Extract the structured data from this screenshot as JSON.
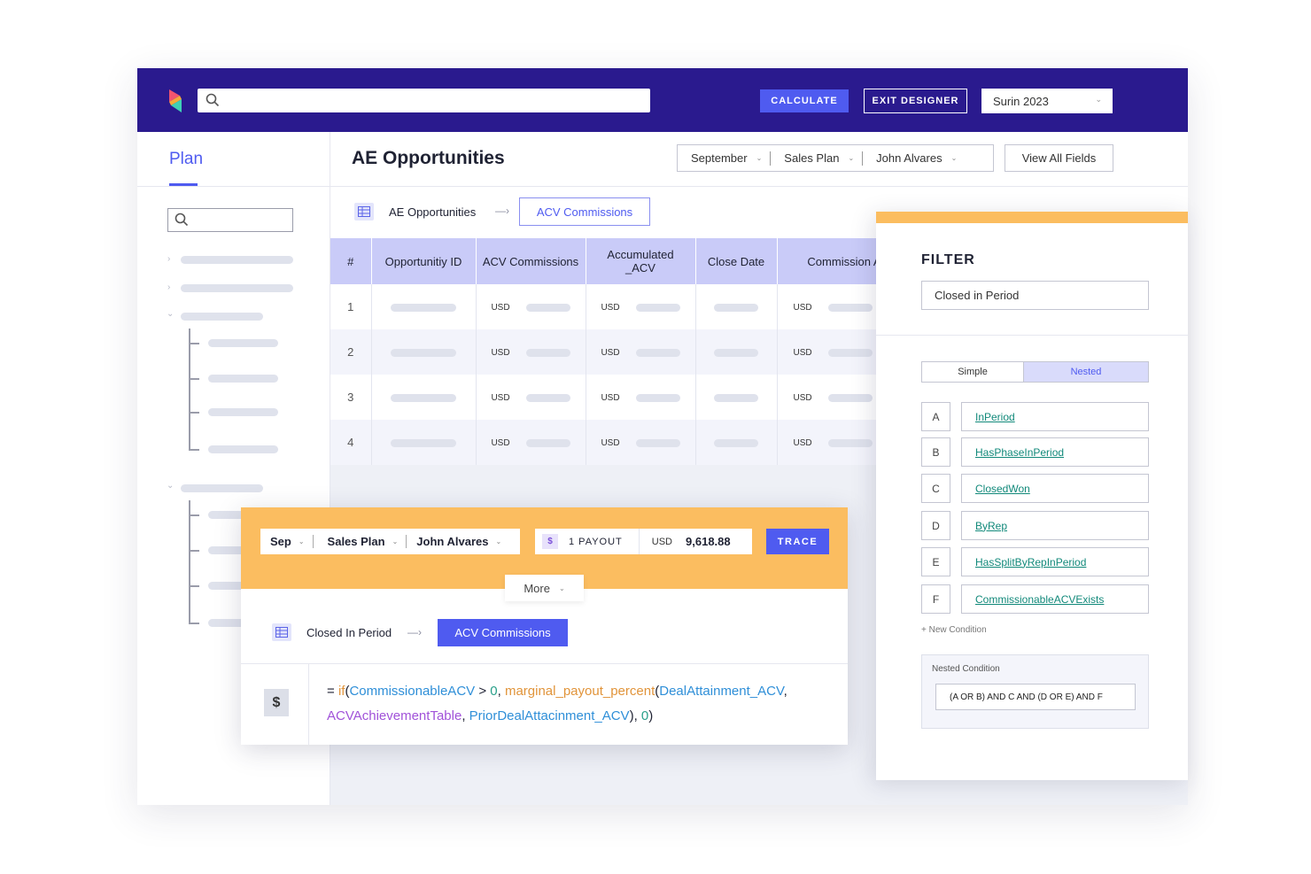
{
  "topbar": {
    "calculate_label": "CALCULATE",
    "exit_label": "EXIT DESIGNER",
    "plan_year": "Surin 2023"
  },
  "sidebar": {
    "tab_label": "Plan"
  },
  "main": {
    "title": "AE Opportunities",
    "filters": [
      "September",
      "Sales Plan",
      "John Alvares"
    ],
    "view_all_label": "View All Fields",
    "breadcrumb_source": "AE Opportunities",
    "breadcrumb_target": "ACV Commissions"
  },
  "table": {
    "headers": [
      "#",
      "Opportunitiy ID",
      "ACV Commissions",
      "Accumulated _ACV",
      "Close Date",
      "Commission ACV"
    ],
    "currency": "USD",
    "rows": [
      "1",
      "2",
      "3",
      "4"
    ]
  },
  "filter_panel": {
    "title": "FILTER",
    "filter_value": "Closed in Period",
    "mode_simple": "Simple",
    "mode_nested": "Nested",
    "conditions": [
      {
        "letter": "A",
        "field": "InPeriod"
      },
      {
        "letter": "B",
        "field": "HasPhaseInPeriod"
      },
      {
        "letter": "C",
        "field": "ClosedWon"
      },
      {
        "letter": "D",
        "field": "ByRep"
      },
      {
        "letter": "E",
        "field": "HasSplitByRepInPeriod"
      },
      {
        "letter": "F",
        "field": "CommissionableACVExists"
      }
    ],
    "new_condition_label": "+ New Condition",
    "nested_label": "Nested Condition",
    "nested_value": "(A OR B) AND C AND (D OR E) AND F"
  },
  "trace_card": {
    "period": "Sep",
    "plan": "Sales Plan",
    "rep": "John Alvares",
    "payout_icon": "$",
    "payout_label": "1 PAYOUT",
    "currency": "USD",
    "payout_value": "9,618.88",
    "trace_label": "TRACE",
    "more_label": "More",
    "breadcrumb_source": "Closed In Period",
    "breadcrumb_target": "ACV Commissions",
    "formula_icon": "$",
    "formula": {
      "eq": "= ",
      "if": "if",
      "open": "(",
      "field1": "CommissionableACV",
      "gt": " > ",
      "zero1": "0",
      "comma": ", ",
      "func": "marginal_payout_percent",
      "open2": "(",
      "field2": "DealAttainment_ACV",
      "comma2": ", ",
      "field3": "ACVAchievementTable",
      "comma3": ", ",
      "field4": "PriorDealAttacinment_ACV",
      "close": "), ",
      "zero2": "0",
      "close2": ")"
    }
  }
}
